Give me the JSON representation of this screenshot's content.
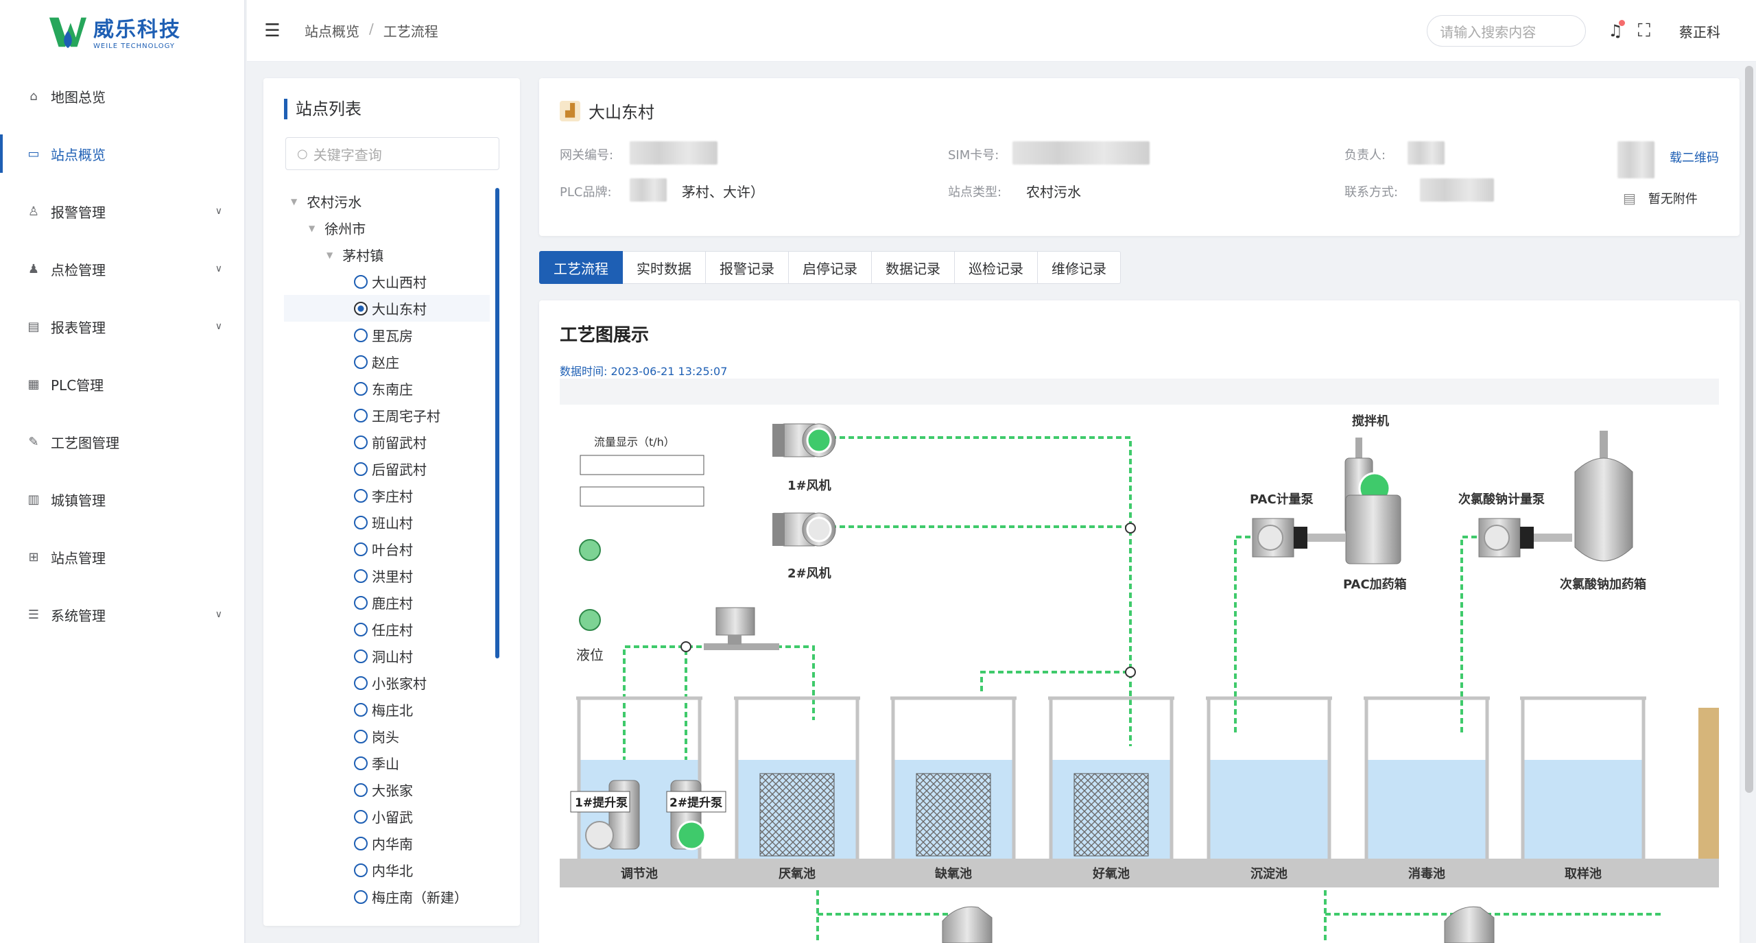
{
  "brand": {
    "name_cn": "威乐科技",
    "name_en": "WEILE TECHNOLOGY"
  },
  "sidebar": {
    "items": [
      {
        "label": "地图总览",
        "icon": "home-icon"
      },
      {
        "label": "站点概览",
        "icon": "monitor-icon"
      },
      {
        "label": "报警管理",
        "icon": "alarm-icon"
      },
      {
        "label": "点检管理",
        "icon": "user-check-icon"
      },
      {
        "label": "报表管理",
        "icon": "report-icon"
      },
      {
        "label": "PLC管理",
        "icon": "grid-icon"
      },
      {
        "label": "工艺图管理",
        "icon": "edit-icon"
      },
      {
        "label": "城镇管理",
        "icon": "building-icon"
      },
      {
        "label": "站点管理",
        "icon": "site-icon"
      },
      {
        "label": "系统管理",
        "icon": "settings-icon"
      }
    ]
  },
  "header": {
    "breadcrumb": [
      "站点概览",
      "工艺流程"
    ],
    "search_placeholder": "请输入搜索内容",
    "user": "蔡正科"
  },
  "station_list": {
    "title": "站点列表",
    "search_placeholder": "关键字查询",
    "tree": {
      "root": "农村污水",
      "city": "徐州市",
      "town": "茅村镇",
      "villages": [
        "大山西村",
        "大山东村",
        "里瓦房",
        "赵庄",
        "东南庄",
        "王周宅子村",
        "前留武村",
        "后留武村",
        "李庄村",
        "班山村",
        "叶台村",
        "洪里村",
        "鹿庄村",
        "任庄村",
        "洞山村",
        "小张家村",
        "梅庄北",
        "岗头",
        "季山",
        "大张家",
        "小留武",
        "内华南",
        "内华北",
        "梅庄南（新建）"
      ],
      "selected": "大山东村"
    }
  },
  "site_info": {
    "name": "大山东村",
    "gateway_label": "网关编号:",
    "sim_label": "SIM卡号:",
    "owner_label": "负责人:",
    "plc_label": "PLC品牌:",
    "plc_value_tail": "茅村、大许）",
    "type_label": "站点类型:",
    "type_value": "农村污水",
    "contact_label": "联系方式:",
    "qr_link": "载二维码",
    "attachment": "暂无附件"
  },
  "tabs": [
    {
      "label": "工艺流程",
      "active": true
    },
    {
      "label": "实时数据",
      "active": false
    },
    {
      "label": "报警记录",
      "active": false
    },
    {
      "label": "启停记录",
      "active": false
    },
    {
      "label": "数据记录",
      "active": false
    },
    {
      "label": "巡检记录",
      "active": false
    },
    {
      "label": "维修记录",
      "active": false
    }
  ],
  "process": {
    "title": "工艺图展示",
    "data_time": "数据时间:  2023-06-21 13:25:07",
    "flow_label": "流量显示（t/h）",
    "level_label": "液位",
    "blowers": [
      "1#风机",
      "2#风机"
    ],
    "mixer": "搅拌机",
    "pac_pump": "PAC计量泵",
    "pac_tank": "PAC加药箱",
    "naclo_pump": "次氯酸钠计量泵",
    "naclo_tank": "次氯酸钠加药箱",
    "lift_pumps": [
      "1#提升泵",
      "2#提升泵"
    ],
    "tanks": [
      "调节池",
      "厌氧池",
      "缺氧池",
      "好氧池",
      "沉淀池",
      "消毒池",
      "取样池"
    ],
    "colors": {
      "pipe": "#3fca6b",
      "water": "#c6e2f7",
      "status_on": "#3fca6b",
      "floor": "#c8c8c8"
    }
  }
}
